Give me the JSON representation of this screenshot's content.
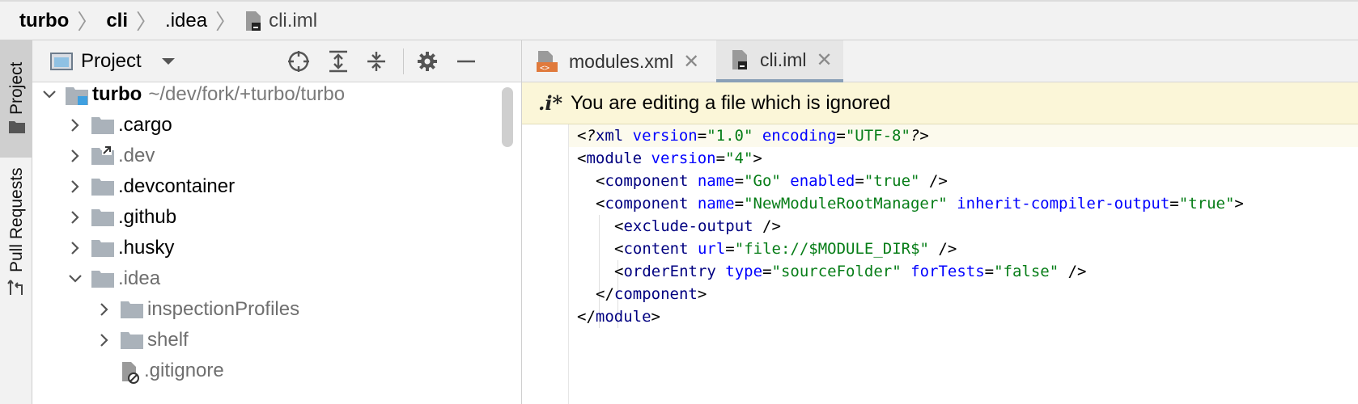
{
  "breadcrumb": {
    "items": [
      "turbo",
      "cli",
      ".idea",
      "cli.iml"
    ]
  },
  "toolstrip": {
    "project_label": "Project",
    "pull_requests_label": "Pull Requests"
  },
  "project_panel": {
    "title": "Project",
    "tree": [
      {
        "name": "turbo",
        "path": "~/dev/fork/+turbo/turbo",
        "expanded": true,
        "depth": 0,
        "kind": "module"
      },
      {
        "name": ".cargo",
        "expanded": false,
        "depth": 1,
        "kind": "folder"
      },
      {
        "name": ".dev",
        "expanded": false,
        "depth": 1,
        "kind": "symlink-folder"
      },
      {
        "name": ".devcontainer",
        "expanded": false,
        "depth": 1,
        "kind": "folder"
      },
      {
        "name": ".github",
        "expanded": false,
        "depth": 1,
        "kind": "folder"
      },
      {
        "name": ".husky",
        "expanded": false,
        "depth": 1,
        "kind": "folder"
      },
      {
        "name": ".idea",
        "expanded": true,
        "depth": 1,
        "kind": "folder"
      },
      {
        "name": "inspectionProfiles",
        "expanded": false,
        "depth": 2,
        "kind": "folder"
      },
      {
        "name": "shelf",
        "expanded": false,
        "depth": 2,
        "kind": "folder"
      },
      {
        "name": ".gitignore",
        "depth": 2,
        "kind": "ignored-file"
      }
    ]
  },
  "editor": {
    "tabs": [
      {
        "label": "modules.xml",
        "active": false
      },
      {
        "label": "cli.iml",
        "active": true
      }
    ],
    "notice": {
      "icon_text": ".i*",
      "text": "You are editing a file which is ignored"
    },
    "code": {
      "l1": {
        "a": "<?",
        "b": "xml ",
        "c": "version",
        "d": "=",
        "e": "\"1.0\"",
        "f": " ",
        "g": "encoding",
        "h": "=",
        "i": "\"UTF-8\"",
        "j": "?>"
      },
      "l2": {
        "a": "<",
        "b": "module ",
        "c": "version",
        "d": "=",
        "e": "\"4\"",
        "f": ">"
      },
      "l3": {
        "a": "<",
        "b": "component ",
        "c": "name",
        "d": "=",
        "e": "\"Go\"",
        "f": " ",
        "g": "enabled",
        "h": "=",
        "i": "\"true\"",
        "j": " />"
      },
      "l4": {
        "a": "<",
        "b": "component ",
        "c": "name",
        "d": "=",
        "e": "\"NewModuleRootManager\"",
        "f": " ",
        "g": "inherit-compiler-output",
        "h": "=",
        "i": "\"true\"",
        "j": ">"
      },
      "l5": {
        "a": "<",
        "b": "exclude-output",
        "c": " />"
      },
      "l6": {
        "a": "<",
        "b": "content ",
        "c": "url",
        "d": "=",
        "e": "\"file://$MODULE_DIR$\"",
        "f": " />"
      },
      "l7": {
        "a": "<",
        "b": "orderEntry ",
        "c": "type",
        "d": "=",
        "e": "\"sourceFolder\"",
        "f": " ",
        "g": "forTests",
        "h": "=",
        "i": "\"false\"",
        "j": " />"
      },
      "l8": {
        "a": "</",
        "b": "component",
        "c": ">"
      },
      "l9": {
        "a": "</",
        "b": "module",
        "c": ">"
      }
    }
  },
  "colors": {
    "tag": "#000080",
    "attribute": "#0000ff",
    "value": "#067d17",
    "notice_bg": "#fbf6d8",
    "active_tab_underline": "#8aa0b7"
  }
}
